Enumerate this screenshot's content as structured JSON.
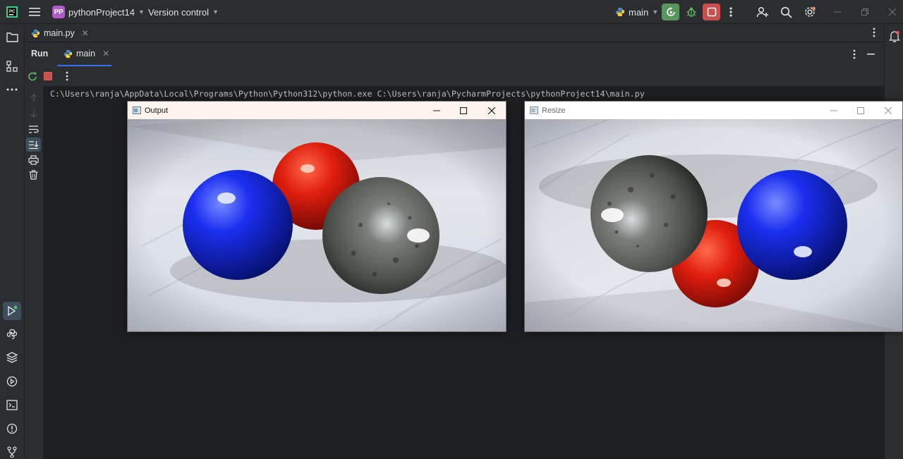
{
  "titlebar": {
    "project_badge": "PP",
    "project_name": "pythonProject14",
    "vcs_label": "Version control",
    "run_config": "main"
  },
  "editor": {
    "tab_label": "main.py"
  },
  "run": {
    "title": "Run",
    "tab_label": "main"
  },
  "console": {
    "lines": [
      "C:\\Users\\ranja\\AppData\\Local\\Programs\\Python\\Python312\\python.exe C:\\Users\\ranja\\PycharmProjects\\pythonProject14\\main.py"
    ]
  },
  "windows": [
    {
      "title": "Output",
      "content": "image: red, blue and metallic marbles on a white wooden surface"
    },
    {
      "title": "Resize",
      "content": "image: rotated view of metallic, red and blue marbles"
    }
  ],
  "colors": {
    "run_green": "#57965c",
    "stop_red": "#c94f4f",
    "badge_purple": "#b15ac9"
  }
}
